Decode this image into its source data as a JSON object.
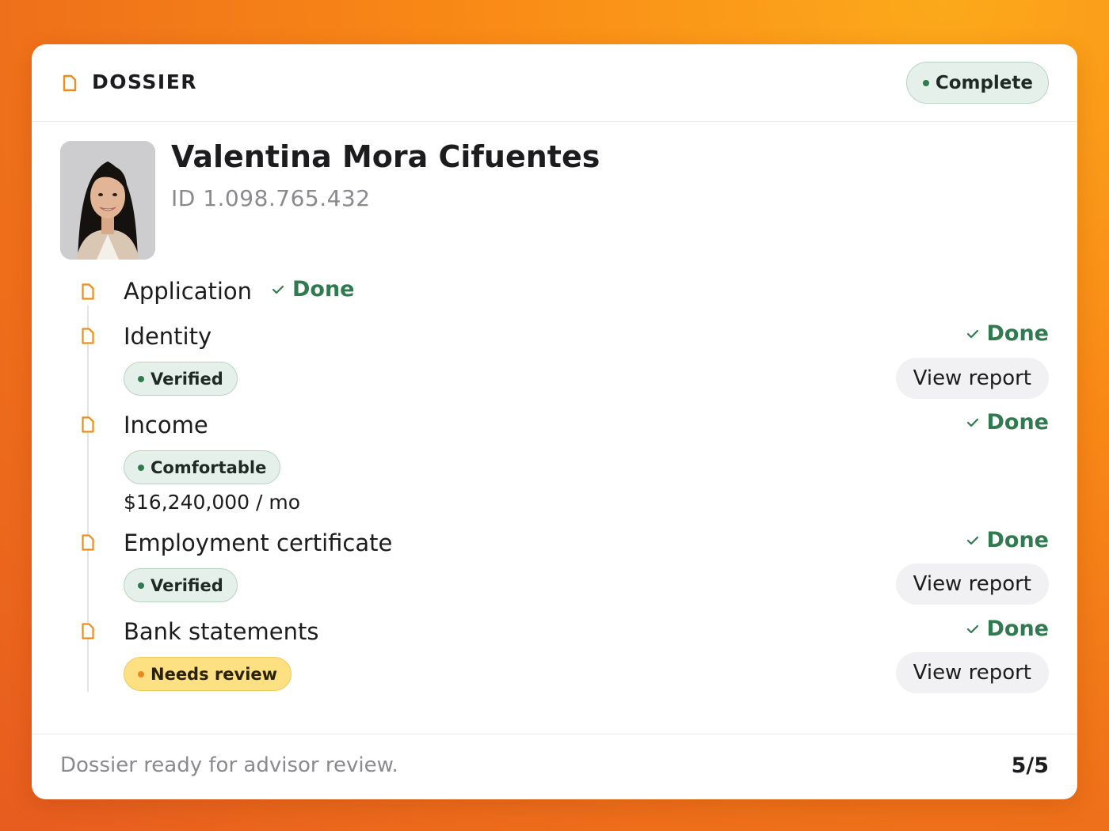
{
  "header": {
    "title": "DOSSIER",
    "status": "Complete"
  },
  "profile": {
    "name": "Valentina Mora Cifuentes",
    "id_text": "ID 1.098.765.432"
  },
  "steps": [
    {
      "title": "Application",
      "status": "Done"
    },
    {
      "title": "Identity",
      "status": "Done",
      "badge": "Verified",
      "action": "View report"
    },
    {
      "title": "Income",
      "status": "Done",
      "badge": "Comfortable",
      "amount": "$16,240,000 / mo"
    },
    {
      "title": "Employment certificate",
      "status": "Done",
      "badge": "Verified",
      "action": "View report"
    },
    {
      "title": "Bank statements",
      "status": "Done",
      "badge": "Needs review",
      "action": "View report"
    }
  ],
  "footer": {
    "message": "Dossier ready for advisor review.",
    "progress": "5/5"
  },
  "colors": {
    "accent_orange": "#ee8c1c",
    "done_green": "#2f7a4e",
    "badge_green_bg": "#e6f0ea",
    "badge_yellow_bg": "#fde082"
  },
  "icons": {
    "header": "document-icon",
    "step": "document-icon",
    "status": "check-icon"
  }
}
